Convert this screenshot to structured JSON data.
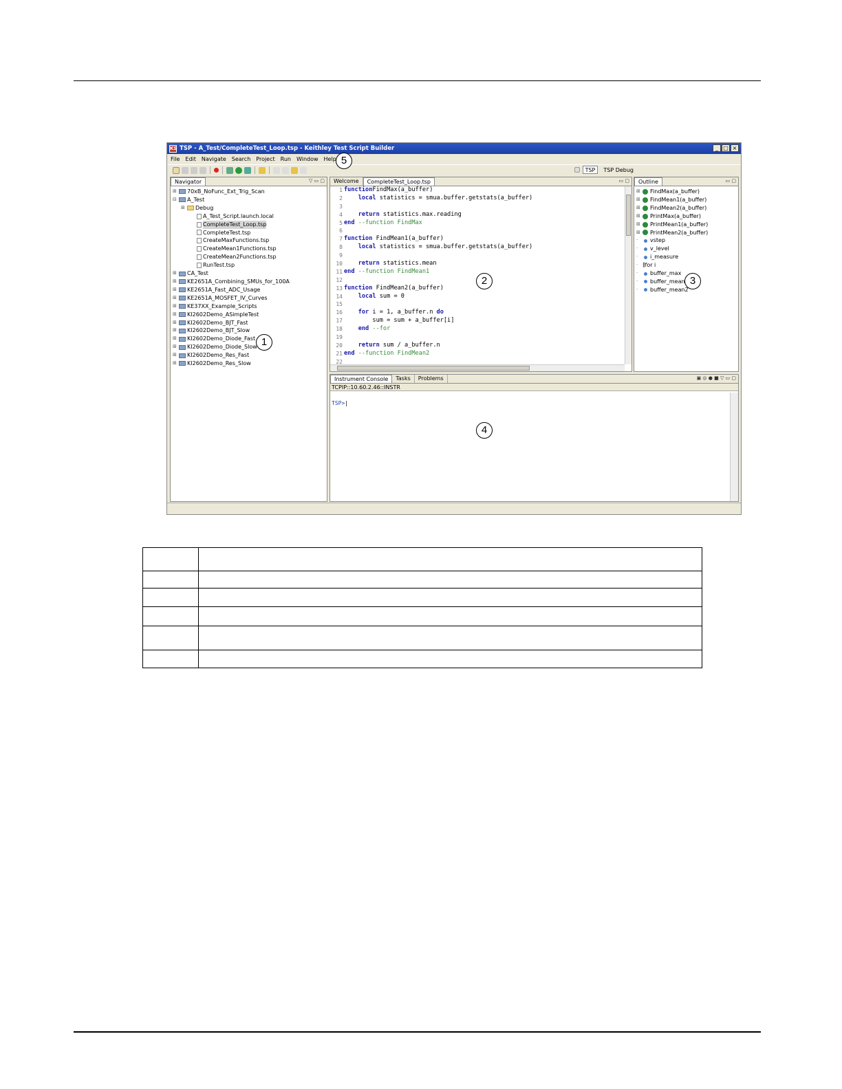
{
  "window": {
    "title": "TSP - A_Test/CompleteTest_Loop.tsp - Keithley Test Script Builder",
    "icon_text": "KS",
    "menu": [
      "File",
      "Edit",
      "Navigate",
      "Search",
      "Project",
      "Run",
      "Window",
      "Help"
    ],
    "perspectives": [
      "TSP",
      "TSP Debug"
    ],
    "status_text": ""
  },
  "navigator": {
    "tab_label": "Navigator",
    "items": [
      {
        "label": "70xB_NoFunc_Ext_Trig_Scan",
        "type": "project",
        "indent": 0
      },
      {
        "label": "A_Test",
        "type": "project",
        "indent": 0
      },
      {
        "label": "Debug",
        "type": "folder",
        "indent": 1
      },
      {
        "label": "A_Test_Script.launch.local",
        "type": "file",
        "indent": 2
      },
      {
        "label": "CompleteTest_Loop.tsp",
        "type": "file",
        "indent": 2,
        "selected": true
      },
      {
        "label": "CompleteTest.tsp",
        "type": "file",
        "indent": 2
      },
      {
        "label": "CreateMaxFunctions.tsp",
        "type": "file",
        "indent": 2
      },
      {
        "label": "CreateMean1Functions.tsp",
        "type": "file",
        "indent": 2
      },
      {
        "label": "CreateMean2Functions.tsp",
        "type": "file",
        "indent": 2
      },
      {
        "label": "RunTest.tsp",
        "type": "file",
        "indent": 2
      },
      {
        "label": "CA_Test",
        "type": "project",
        "indent": 0
      },
      {
        "label": "KE2651A_Combining_SMUs_for_100A",
        "type": "project",
        "indent": 0
      },
      {
        "label": "KE2651A_Fast_ADC_Usage",
        "type": "project",
        "indent": 0
      },
      {
        "label": "KE2651A_MOSFET_IV_Curves",
        "type": "project",
        "indent": 0
      },
      {
        "label": "KE37XX_Example_Scripts",
        "type": "project",
        "indent": 0
      },
      {
        "label": "KI2602Demo_ASimpleTest",
        "type": "project",
        "indent": 0
      },
      {
        "label": "KI2602Demo_BJT_Fast",
        "type": "project",
        "indent": 0
      },
      {
        "label": "KI2602Demo_BJT_Slow",
        "type": "project",
        "indent": 0
      },
      {
        "label": "KI2602Demo_Diode_Fast",
        "type": "project",
        "indent": 0
      },
      {
        "label": "KI2602Demo_Diode_Slow",
        "type": "project",
        "indent": 0
      },
      {
        "label": "KI2602Demo_Res_Fast",
        "type": "project",
        "indent": 0
      },
      {
        "label": "KI2602Demo_Res_Slow",
        "type": "project",
        "indent": 0
      }
    ]
  },
  "editor": {
    "tabs": [
      "Welcome",
      "CompleteTest_Loop.tsp"
    ],
    "lines": [
      {
        "n": "1",
        "parts": [
          [
            "kw",
            "function"
          ],
          [
            "",
            "FindMax(a_buffer)"
          ]
        ]
      },
      {
        "n": "2",
        "parts": [
          [
            "",
            "    "
          ],
          [
            "kw",
            "local"
          ],
          [
            "",
            " statistics = smua.buffer.getstats(a_buffer)"
          ]
        ]
      },
      {
        "n": "3",
        "parts": []
      },
      {
        "n": "4",
        "parts": [
          [
            "",
            "    "
          ],
          [
            "kw",
            "return"
          ],
          [
            "",
            " statistics.max.reading"
          ]
        ]
      },
      {
        "n": "5",
        "parts": [
          [
            "kw",
            "end"
          ],
          [
            "cm",
            " --function FindMax"
          ]
        ]
      },
      {
        "n": "6",
        "parts": []
      },
      {
        "n": "7",
        "parts": [
          [
            "kw",
            "function"
          ],
          [
            "",
            " FindMean1(a_buffer)"
          ]
        ]
      },
      {
        "n": "8",
        "parts": [
          [
            "",
            "    "
          ],
          [
            "kw",
            "local"
          ],
          [
            "",
            " statistics = smua.buffer.getstats(a_buffer)"
          ]
        ]
      },
      {
        "n": "9",
        "parts": []
      },
      {
        "n": "10",
        "parts": [
          [
            "",
            "    "
          ],
          [
            "kw",
            "return"
          ],
          [
            "",
            " statistics.mean"
          ]
        ]
      },
      {
        "n": "11",
        "parts": [
          [
            "kw",
            "end"
          ],
          [
            "cm",
            " --function FindMean1"
          ]
        ]
      },
      {
        "n": "12",
        "parts": []
      },
      {
        "n": "13",
        "parts": [
          [
            "kw",
            "function"
          ],
          [
            "",
            " FindMean2(a_buffer)"
          ]
        ]
      },
      {
        "n": "14",
        "parts": [
          [
            "",
            "    "
          ],
          [
            "kw",
            "local"
          ],
          [
            "",
            " sum = 0"
          ]
        ]
      },
      {
        "n": "15",
        "parts": []
      },
      {
        "n": "16",
        "parts": [
          [
            "",
            "    "
          ],
          [
            "kw",
            "for"
          ],
          [
            "",
            " i = 1, a_buffer.n "
          ],
          [
            "kw",
            "do"
          ]
        ]
      },
      {
        "n": "17",
        "parts": [
          [
            "",
            "        sum = sum + a_buffer[i]"
          ]
        ]
      },
      {
        "n": "18",
        "parts": [
          [
            "",
            "    "
          ],
          [
            "kw",
            "end"
          ],
          [
            "cm",
            " --for"
          ]
        ]
      },
      {
        "n": "19",
        "parts": []
      },
      {
        "n": "20",
        "parts": [
          [
            "",
            "    "
          ],
          [
            "kw",
            "return"
          ],
          [
            "",
            " sum / a_buffer.n"
          ]
        ]
      },
      {
        "n": "21",
        "parts": [
          [
            "kw",
            "end"
          ],
          [
            "cm",
            " --function FindMean2"
          ]
        ]
      },
      {
        "n": "22",
        "parts": []
      }
    ]
  },
  "outline": {
    "tab_label": "Outline",
    "items": [
      {
        "label": "FindMax(a_buffer)",
        "type": "function"
      },
      {
        "label": "FindMean1(a_buffer)",
        "type": "function"
      },
      {
        "label": "FindMean2(a_buffer)",
        "type": "function"
      },
      {
        "label": "PrintMax(a_buffer)",
        "type": "function"
      },
      {
        "label": "PrintMean1(a_buffer)",
        "type": "function"
      },
      {
        "label": "PrintMean2(a_buffer)",
        "type": "function"
      },
      {
        "label": "vstep",
        "type": "var"
      },
      {
        "label": "v_level",
        "type": "var"
      },
      {
        "label": "i_measure",
        "type": "var"
      },
      {
        "label": "for i",
        "type": "loop"
      },
      {
        "label": "buffer_max",
        "type": "var"
      },
      {
        "label": "buffer_mean1",
        "type": "var"
      },
      {
        "label": "buffer_mean2",
        "type": "var"
      }
    ]
  },
  "console": {
    "tabs": [
      "Instrument Console",
      "Tasks",
      "Problems"
    ],
    "address": "TCPIP::10.60.2.46::INSTR",
    "prompt": "TSP>"
  },
  "callouts": [
    "1",
    "2",
    "3",
    "4",
    "5"
  ],
  "colors": {
    "titlebar": "#1c3fa6",
    "keyword": "#1a1aa6",
    "comment": "#3a8a3a",
    "prompt": "#2244aa"
  }
}
